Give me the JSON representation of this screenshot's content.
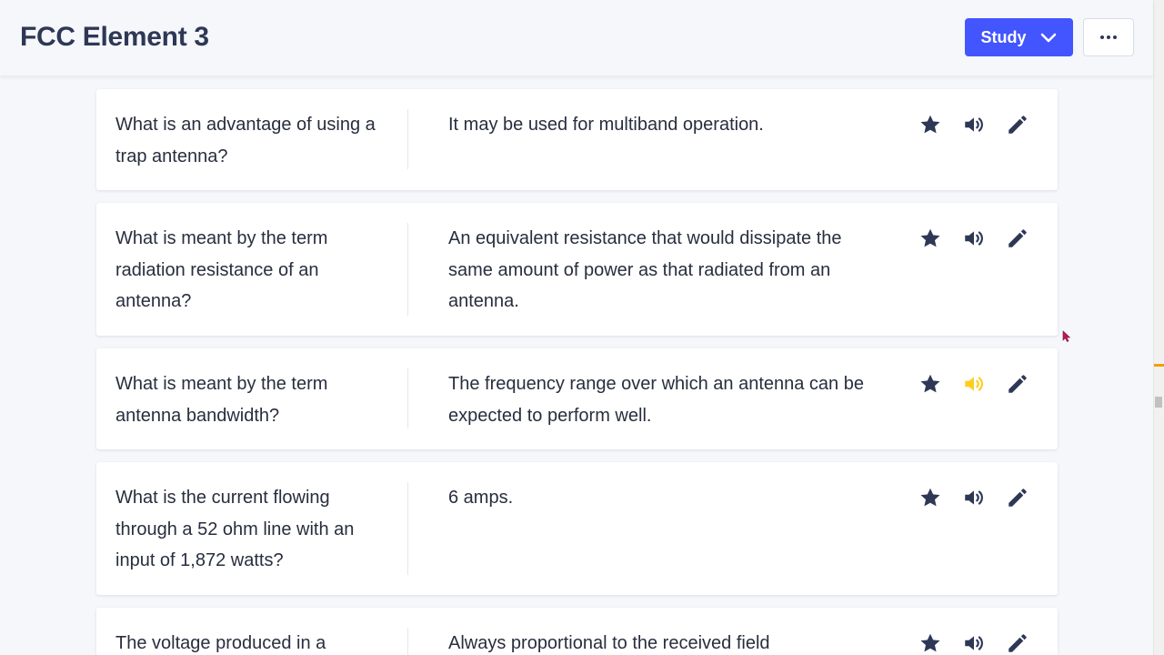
{
  "header": {
    "title": "FCC Element 3",
    "study_label": "Study"
  },
  "colors": {
    "accent": "#4255ff",
    "icon": "#2e3856",
    "audio_active": "#ffcd1f"
  },
  "cards": [
    {
      "term": "What is an advantage of using a trap antenna?",
      "definition": "It may be used for multiband operation.",
      "audio_active": false
    },
    {
      "term": "What is meant by the term radiation resistance of an antenna?",
      "definition": "An equivalent resistance that would dissipate the same amount of power as that radiated from an antenna.",
      "audio_active": false
    },
    {
      "term": "What is meant by the term antenna bandwidth?",
      "definition": "The frequency range over which an antenna can be expected to perform well.",
      "audio_active": true
    },
    {
      "term": "What is the current flowing through a 52 ohm line with an input of 1,872 watts?",
      "definition": "6 amps.",
      "audio_active": false
    },
    {
      "term": "The voltage produced in a",
      "definition": "Always proportional to the received field",
      "audio_active": false
    }
  ],
  "icons": {
    "star": "star-icon",
    "audio": "speaker-icon",
    "edit": "pencil-icon",
    "chevron": "chevron-down-icon",
    "more": "more-horizontal-icon"
  }
}
